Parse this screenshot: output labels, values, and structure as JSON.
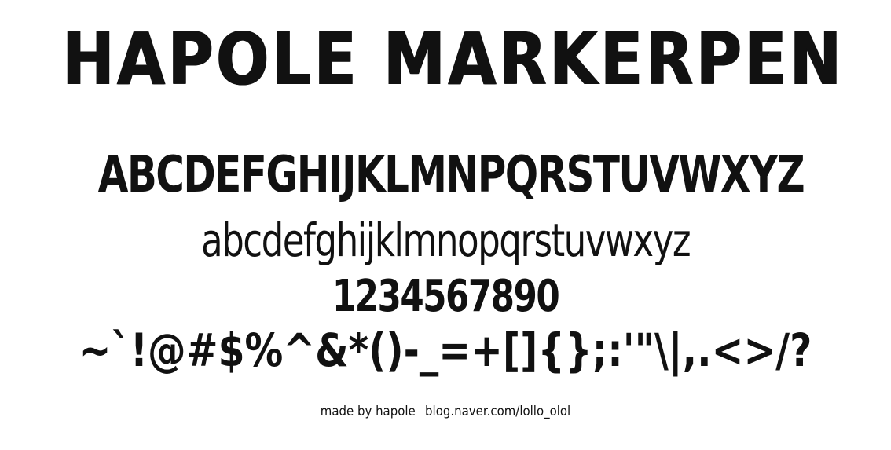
{
  "specimen": {
    "title": "HAPOLE MARKERPEN",
    "uppercase": "ABCDEFGHIJKLMNPQRSTUVWXYZ",
    "lowercase": "abcdefghijklmnopqrstuvwxyz",
    "digits": "1234567890",
    "symbols": "~`!@#$%^&*()-_=+[]{};:'\"\\|,.<>/?",
    "credit_author": "made by hapole",
    "credit_url": "blog.naver.com/lollo_olol"
  }
}
